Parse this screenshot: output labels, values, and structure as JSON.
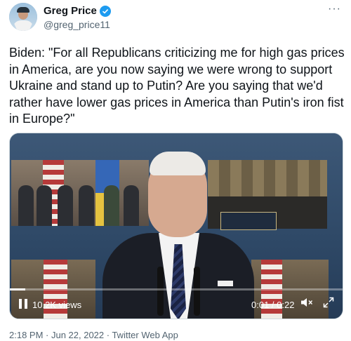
{
  "author": {
    "display_name": "Greg Price",
    "handle": "@greg_price11",
    "verified": true
  },
  "menu": {
    "more_label": "···"
  },
  "tweet": {
    "text": "Biden: \"For all Republicans criticizing me for high gas prices in America, are you now saying we were wrong to support Ukraine and stand up to Putin? Are you saying that we'd rather have lower gas prices in America than Putin's iron fist in Europe?\""
  },
  "video": {
    "views": "10.2K views",
    "time": "0:01 / 0:22",
    "progress_fraction": 0.0455,
    "controls": {
      "pause_icon": "pause-icon",
      "mute_icon": "speaker-muted-icon",
      "expand_icon": "fullscreen-icon"
    }
  },
  "meta": {
    "timestamp": "2:18 PM · Jun 22, 2022 · Twitter Web App"
  },
  "colors": {
    "verified_blue": "#1d9bf0",
    "secondary_text": "#536471"
  }
}
